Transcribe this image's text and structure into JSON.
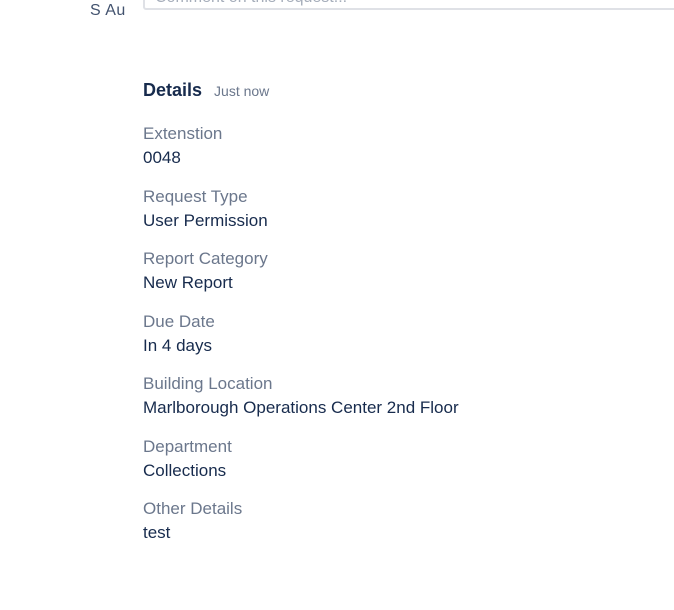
{
  "comment": {
    "avatar_text": "S Au",
    "placeholder": "Comment on this request..."
  },
  "details": {
    "title": "Details",
    "timestamp": "Just now",
    "fields": [
      {
        "label": "Extenstion",
        "value": "0048"
      },
      {
        "label": "Request Type",
        "value": "User Permission"
      },
      {
        "label": "Report Category",
        "value": "New Report"
      },
      {
        "label": "Due Date",
        "value": "In 4 days"
      },
      {
        "label": "Building Location",
        "value": "Marlborough Operations Center 2nd Floor"
      },
      {
        "label": "Department",
        "value": "Collections"
      },
      {
        "label": "Other Details",
        "value": "test"
      }
    ]
  }
}
